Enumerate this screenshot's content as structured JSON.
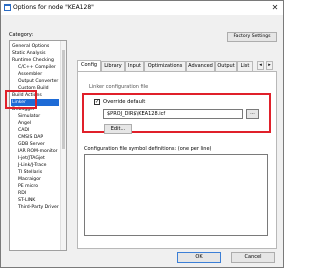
{
  "window": {
    "title": "Options for node \"KEA128\"",
    "close_glyph": "✕",
    "icon_name": "ide-window-icon"
  },
  "category": {
    "label": "Category:",
    "items": [
      {
        "label": "General Options",
        "sub": false
      },
      {
        "label": "Static Analysis",
        "sub": false
      },
      {
        "label": "Runtime Checking",
        "sub": false
      },
      {
        "label": "C/C++ Compiler",
        "sub": true
      },
      {
        "label": "Assembler",
        "sub": true
      },
      {
        "label": "Output Converter",
        "sub": true
      },
      {
        "label": "Custom Build",
        "sub": true
      },
      {
        "label": "Build Actions",
        "sub": true
      },
      {
        "label": "Linker",
        "sub": true,
        "selected": true
      },
      {
        "label": "Debugger",
        "sub": true
      },
      {
        "label": "Simulator",
        "sub": true
      },
      {
        "label": "Angel",
        "sub": true
      },
      {
        "label": "CADI",
        "sub": true
      },
      {
        "label": "CMSIS DAP",
        "sub": true
      },
      {
        "label": "GDB Server",
        "sub": true
      },
      {
        "label": "IAR ROM-monitor",
        "sub": true
      },
      {
        "label": "I-jet/JTAGjet",
        "sub": true
      },
      {
        "label": "J-Link/J-Trace",
        "sub": true
      },
      {
        "label": "TI Stellaris",
        "sub": true
      },
      {
        "label": "Macraigor",
        "sub": true
      },
      {
        "label": "PE micro",
        "sub": true
      },
      {
        "label": "RDI",
        "sub": true
      },
      {
        "label": "ST-LINK",
        "sub": true
      },
      {
        "label": "Third-Party Driver",
        "sub": true
      }
    ]
  },
  "factory_settings_label": "Factory Settings",
  "tabs": [
    {
      "label": "Config",
      "active": true
    },
    {
      "label": "Library",
      "active": false
    },
    {
      "label": "Input",
      "active": false
    },
    {
      "label": "Optimizations",
      "active": false
    },
    {
      "label": "Advanced",
      "active": false
    },
    {
      "label": "Output",
      "active": false
    },
    {
      "label": "List",
      "active": false
    }
  ],
  "tab_scroll": {
    "left": "◂",
    "right": "▸"
  },
  "config": {
    "group_label": "Linker configuration file",
    "override_label": "Override default",
    "override_checked": true,
    "check_glyph": "✓",
    "path_value": "$PROJ_DIR$\\KEA128.icf",
    "browse_label": "...",
    "edit_label": "Edit...",
    "symdef_label": "Configuration file symbol definitions: (one per line)",
    "symdef_value": ""
  },
  "footer": {
    "ok_label": "OK",
    "cancel_label": "Cancel"
  },
  "colors": {
    "highlight_red": "#e0202a",
    "selection_blue": "#1e6bd6"
  }
}
